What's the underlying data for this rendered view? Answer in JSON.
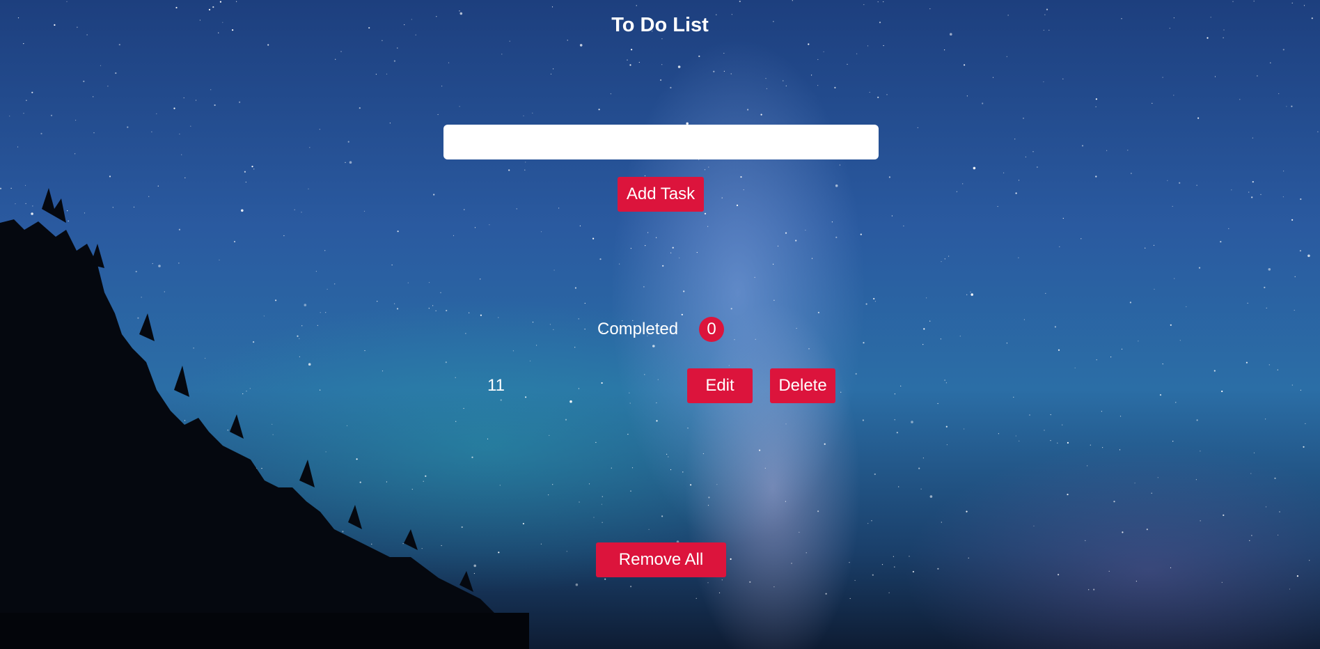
{
  "app": {
    "title": "To Do List"
  },
  "input": {
    "value": "",
    "placeholder": ""
  },
  "buttons": {
    "add_task": "Add Task",
    "remove_all": "Remove All"
  },
  "completed": {
    "label": "Completed",
    "count": "0"
  },
  "tasks": [
    {
      "text": "11",
      "edit_label": "Edit",
      "delete_label": "Delete"
    }
  ],
  "colors": {
    "accent": "#dc143c",
    "text": "#ffffff",
    "input_background": "#ffffff"
  },
  "background": {
    "description_icon": "starry-night-sky-image"
  }
}
